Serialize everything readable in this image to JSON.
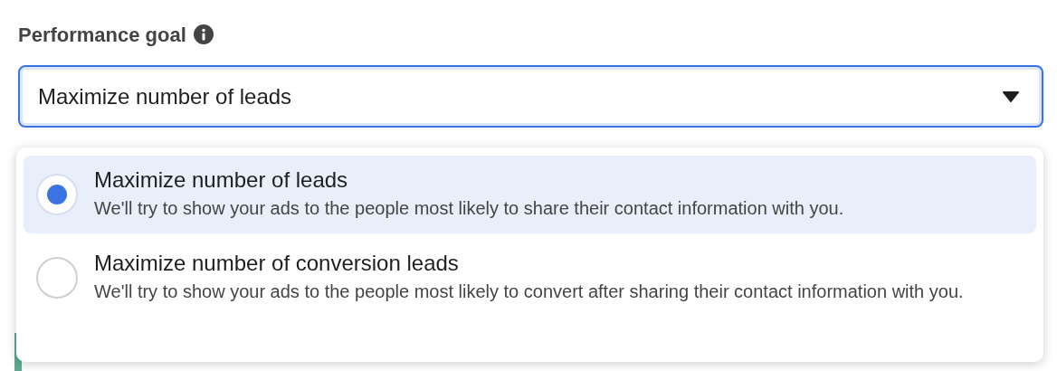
{
  "field": {
    "label": "Performance goal",
    "value": "Maximize number of leads",
    "expanded": true
  },
  "options": [
    {
      "title": "Maximize number of leads",
      "description": "We'll try to show your ads to the people most likely to share their contact information with you.",
      "selected": true
    },
    {
      "title": "Maximize number of conversion leads",
      "description": "We'll try to show your ads to the people most likely to convert after sharing their contact information with you.",
      "selected": false
    }
  ]
}
